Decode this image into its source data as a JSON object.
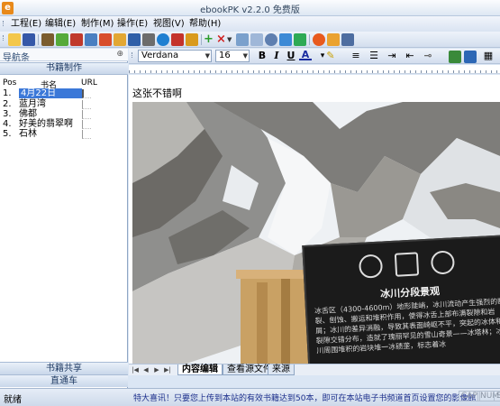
{
  "window": {
    "title": "ebookPK v2.2.0  免费版"
  },
  "menu": {
    "items": [
      "工程(E)",
      "编辑(E)",
      "制作(M)",
      "操作(E)",
      "视图(V)",
      "帮助(H)"
    ]
  },
  "left_panel": {
    "title": "导航条",
    "section_title": "书籍制作",
    "columns": {
      "pos": "Pos",
      "name": "书名",
      "url": "URL"
    },
    "rows": [
      {
        "idx": "1.",
        "name": "4月22日"
      },
      {
        "idx": "2.",
        "name": "蓝月湾"
      },
      {
        "idx": "3.",
        "name": "佛都"
      },
      {
        "idx": "4.",
        "name": "好美的翡翠啊"
      },
      {
        "idx": "5.",
        "name": "石林"
      }
    ],
    "bottom_buttons": [
      "书籍共享",
      "直通车"
    ]
  },
  "format": {
    "font": "Verdana",
    "size": "16"
  },
  "editor": {
    "text": "这张不错啊",
    "sign_title": "冰川分段景观",
    "sign_body": "冰舌区（4300-4600m）地形陡峭，冰川流动产生强烈的断裂、刨蚀、搬运和堆积作用，使得冰舌上部布满裂隙和岩屑；冰川的差异消融，导致其表面崎岖不平，突起的冰体和裂隙交错分布，造就了瑰丽罕见的雪山奇景——冰塔林；冰川周围堆积的岩块堆一冰碛垄，标志着冰"
  },
  "tabs": [
    "内容编辑",
    "查看源文件",
    "来源"
  ],
  "status": {
    "left": "就绪",
    "message": "特大喜讯！只要您上传到本站的有效书籍达到50本，即可在本站电子书频道首页设置您的影像館",
    "flags": [
      "CAP",
      "NUM",
      "S"
    ]
  }
}
